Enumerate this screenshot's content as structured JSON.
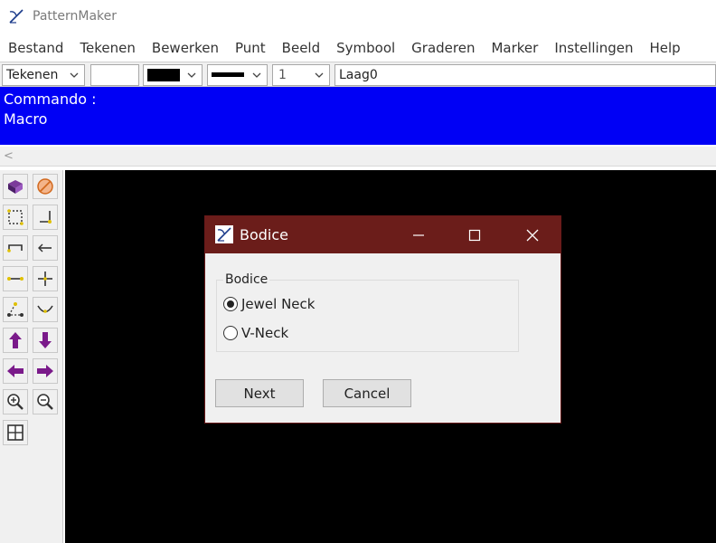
{
  "window": {
    "title": "PatternMaker"
  },
  "menu": [
    "Bestand",
    "Tekenen",
    "Bewerken",
    "Punt",
    "Beeld",
    "Symbool",
    "Graderen",
    "Marker",
    "Instellingen",
    "Help"
  ],
  "toolbar": {
    "mode": "Tekenen",
    "line_width": "1",
    "layer": "Laag0",
    "color": "#000000"
  },
  "command": {
    "line1": "Commando :",
    "line2": "Macro",
    "background": "#0000f5"
  },
  "scroll": {
    "left_arrow": "<"
  },
  "tools": [
    "book-icon",
    "no-entry-icon",
    "select-box-icon",
    "corner-icon",
    "bracket-icon",
    "arrow-left-line-icon",
    "segment-icon",
    "cross-icon",
    "triangle-points-icon",
    "curve-icon",
    "arrow-up-icon",
    "arrow-down-icon",
    "arrow-left-icon",
    "arrow-right-icon",
    "zoom-in-icon",
    "zoom-out-icon",
    "grid-icon"
  ],
  "dialog": {
    "title": "Bodice",
    "title_color": "#6b1d1a",
    "group_label": "Bodice",
    "options": [
      {
        "label": "Jewel Neck",
        "checked": true
      },
      {
        "label": "V-Neck",
        "checked": false
      }
    ],
    "next_label": "Next",
    "cancel_label": "Cancel"
  }
}
